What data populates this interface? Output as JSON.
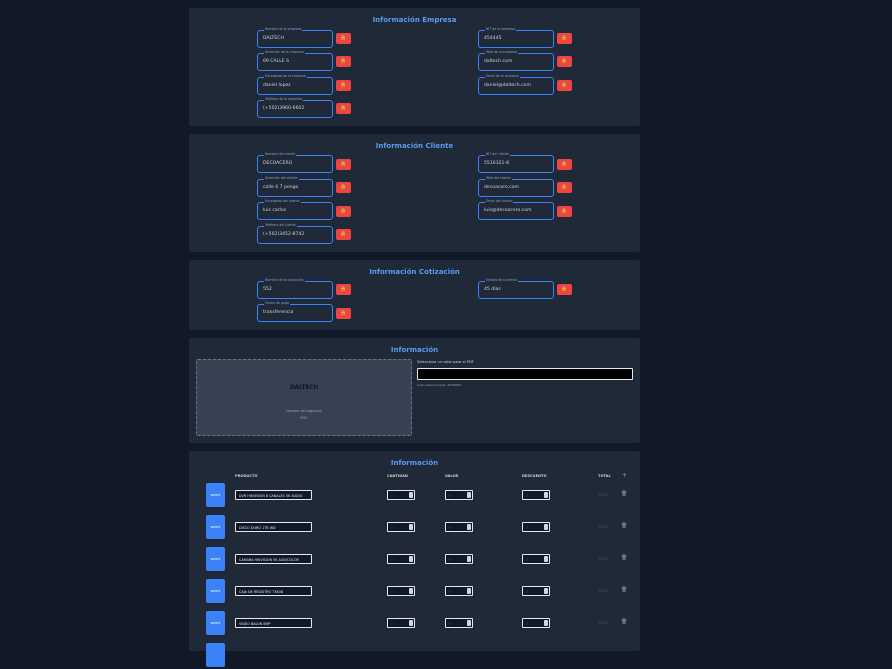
{
  "empresa": {
    "title": "Información Empresa",
    "fields": [
      {
        "label": "Nombre de la empresa",
        "value": "DALTECH"
      },
      {
        "label": "NIT de la empresa",
        "value": "454445"
      },
      {
        "label": "Dirección de la empresa",
        "value": "69 CALLE S"
      },
      {
        "label": "Web de la empresa",
        "value": "daltech.com"
      },
      {
        "label": "Encargado de la empresa",
        "value": "daniel lopez"
      },
      {
        "label": "Email de la empresa",
        "value": "daniel@daltech.com"
      },
      {
        "label": "Teléfono de la empresa",
        "value": "(+502)3960-6602"
      }
    ]
  },
  "cliente": {
    "title": "Información Cliente",
    "fields": [
      {
        "label": "Nombre del cliente",
        "value": "DECOACERO"
      },
      {
        "label": "NIT del cliente",
        "value": "5516321-8"
      },
      {
        "label": "Dirección del cliente",
        "value": "calle 4 7 pongo"
      },
      {
        "label": "Web del cliente",
        "value": "decoacero.com"
      },
      {
        "label": "Encargado del cliente",
        "value": "luis carlos"
      },
      {
        "label": "Email del cliente",
        "value": "luis@decoacero.com"
      },
      {
        "label": "Teléfono del cliente",
        "value": "(+502)3452-8742"
      }
    ]
  },
  "cotizacion": {
    "title": "Información Cotización",
    "fields": [
      {
        "label": "Número de la cotización",
        "value": "552"
      },
      {
        "label": "Validez de la oferta",
        "value": "45 días"
      },
      {
        "label": "Forma de pago",
        "value": "transferencia"
      }
    ]
  },
  "info": {
    "title": "Información",
    "logo_text": "DALTECH",
    "file_name": "nombre-del-logo.png",
    "file_ext": "PNG",
    "color_label": "Selecciona un color para el PDF",
    "color_help": "Color seleccionado: #000000"
  },
  "productos": {
    "title": "Información",
    "headers": {
      "producto": "PRODUCTO",
      "cantidad": "CANTIDAD",
      "valor": "VALOR",
      "descuento": "DESCUENTO",
      "total": "TOTAL"
    },
    "select_label": "select",
    "rows": [
      {
        "producto": "DVR HIKVISION 8 CANALES 5K AUDIO",
        "cantidad": "0",
        "valor": "0",
        "descuento": "0",
        "total": "Q0.00"
      },
      {
        "producto": "DISCO DURO 1TB WD",
        "cantidad": "0",
        "valor": "0",
        "descuento": "0",
        "total": "Q0.00"
      },
      {
        "producto": "CAMARA HIKVISION 5K AUD/COLOR",
        "cantidad": "0",
        "valor": "0",
        "descuento": "0",
        "total": "Q0.00"
      },
      {
        "producto": "CAJA DE REGISTRO T3K08",
        "cantidad": "0",
        "valor": "0",
        "descuento": "0",
        "total": "Q0.00"
      },
      {
        "producto": "VIDEO BALUN 8MP",
        "cantidad": "0",
        "valor": "0",
        "descuento": "0",
        "total": "Q0.00"
      }
    ]
  },
  "icons": {
    "lock": "lock-icon",
    "add": "plus-icon",
    "trash": "trash-icon"
  },
  "colors": {
    "accent": "#3b82f6",
    "danger": "#ef4444",
    "card": "#1f2937",
    "background": "#111827"
  }
}
